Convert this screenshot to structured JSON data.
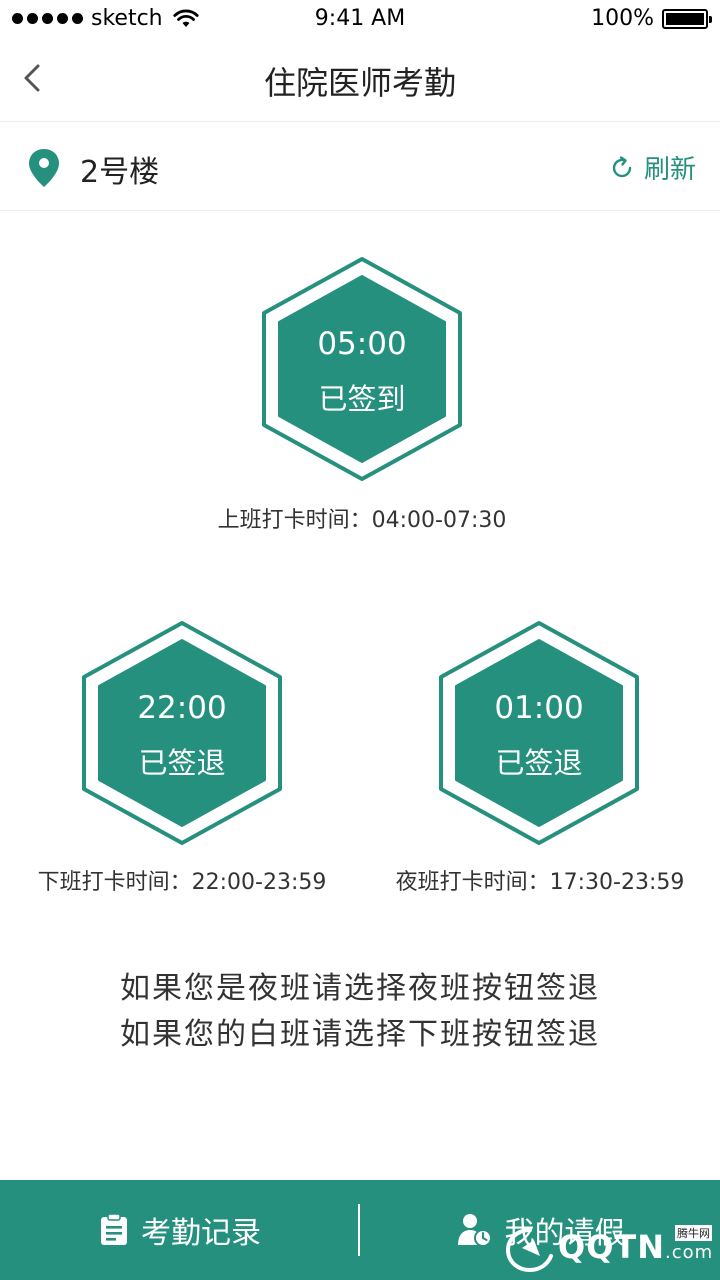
{
  "status_bar": {
    "carrier": "sketch",
    "time": "9:41 AM",
    "battery": "100%"
  },
  "header": {
    "title": "住院医师考勤"
  },
  "location": {
    "building": "2号楼",
    "refresh_label": "刷新"
  },
  "punches": {
    "morning": {
      "time": "05:00",
      "status": "已签到",
      "window": "上班打卡时间：04:00-07:30"
    },
    "evening": {
      "time": "22:00",
      "status": "已签退",
      "window": "下班打卡时间：22:00-23:59"
    },
    "night": {
      "time": "01:00",
      "status": "已签退",
      "window": "夜班打卡时间：17:30-23:59"
    }
  },
  "notes": {
    "line1": "如果您是夜班请选择夜班按钮签退",
    "line2": "如果您的白班请选择下班按钮签退"
  },
  "tabs": {
    "records_label": "考勤记录",
    "leave_label": "我的请假"
  },
  "watermark": {
    "brand": "QQTN",
    "domain": ".com",
    "small": "腾牛网"
  },
  "colors": {
    "accent": "#26907f",
    "text": "#222222"
  },
  "icons": {
    "back": "chevron-left-icon",
    "location": "map-pin-icon",
    "refresh": "refresh-icon",
    "records": "clipboard-icon",
    "leave": "user-clock-icon"
  }
}
